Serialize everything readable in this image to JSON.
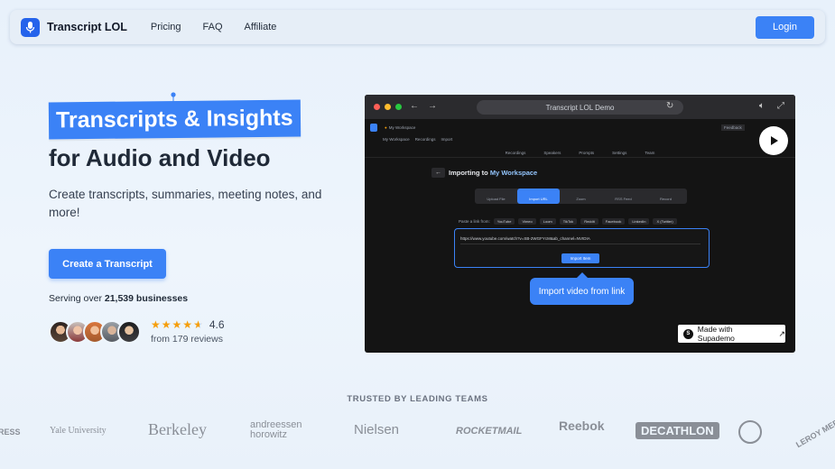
{
  "nav": {
    "brand": "Transcript LOL",
    "links": [
      "Pricing",
      "FAQ",
      "Affiliate"
    ],
    "login": "Login"
  },
  "hero": {
    "highlight": "Transcripts & Insights",
    "title": "for Audio and Video",
    "subtitle": "Create transcripts, summaries, meeting notes, and more!",
    "cta": "Create a Transcript",
    "serving_prefix": "Serving over ",
    "serving_count": "21,539 businesses",
    "rating": "4.6",
    "reviews": "from 179 reviews",
    "stars": 4.6
  },
  "demo": {
    "window_title": "Transcript LOL Demo",
    "workspace": "My Workspace",
    "breadcrumbs": [
      "My Workspace",
      "Recordings",
      "Import"
    ],
    "feedback": "Feedback",
    "tabs": [
      "Recordings",
      "Speakers",
      "Prompts",
      "Settings",
      "Team"
    ],
    "panel_title_prefix": "Importing to ",
    "panel_title_target": "My Workspace",
    "source_tabs": [
      "Upload File",
      "Import URL",
      "Zoom",
      "RSS Feed",
      "Record"
    ],
    "active_source": 1,
    "paste_label": "Paste a link from:",
    "platforms": [
      "YouTube",
      "Vimeo",
      "Loom",
      "TikTok",
      "Reddit",
      "Facebook",
      "LinkedIn",
      "X (Twitter)"
    ],
    "url_value": "https://www.youtube.com/watch?v=SB-2WGFYcM&ab_channel=NVIDIA",
    "import_button": "Import Item",
    "tooltip": "Import video from link",
    "made_with": "Made with Supademo"
  },
  "trusted": {
    "heading": "TRUSTED BY LEADING TEAMS",
    "logos": [
      "RESS",
      "Yale University",
      "Berkeley",
      "andreessen horowitz",
      "Nielsen",
      "ROCKETMAIL",
      "Reebok",
      "DECATHLON",
      "LEROY MERLIN"
    ]
  },
  "colors": {
    "accent": "#3b82f6",
    "background": "#eef5fc"
  }
}
